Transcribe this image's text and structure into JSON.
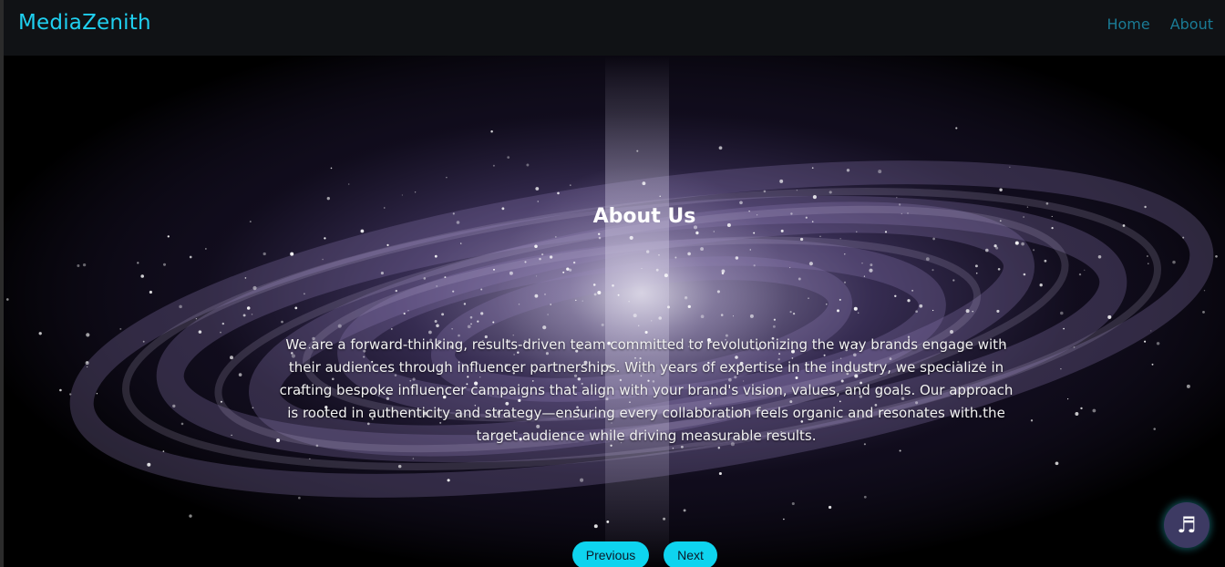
{
  "navbar": {
    "brand": "MediaZenith",
    "links": [
      "Home",
      "About"
    ]
  },
  "hero": {
    "title": "About Us",
    "description": "We are a forward-thinking, results-driven team committed to revolutionizing the way brands engage with their audiences through influencer partnerships. With years of expertise in the industry, we specialize in crafting bespoke influencer campaigns that align with your brand's vision, values, and goals. Our approach is rooted in authenticity and strategy—ensuring every collaboration feels organic and resonates with the target audience while driving measurable results."
  },
  "pager": {
    "previous": "Previous",
    "next": "Next"
  },
  "music": {
    "icon": "♬",
    "icon_name": "music-note-icon"
  },
  "colors": {
    "accent": "#0ed4ef",
    "brand": "#1fd0f0",
    "nav_link": "#1a7b95",
    "navbar_bg": "#101215"
  }
}
